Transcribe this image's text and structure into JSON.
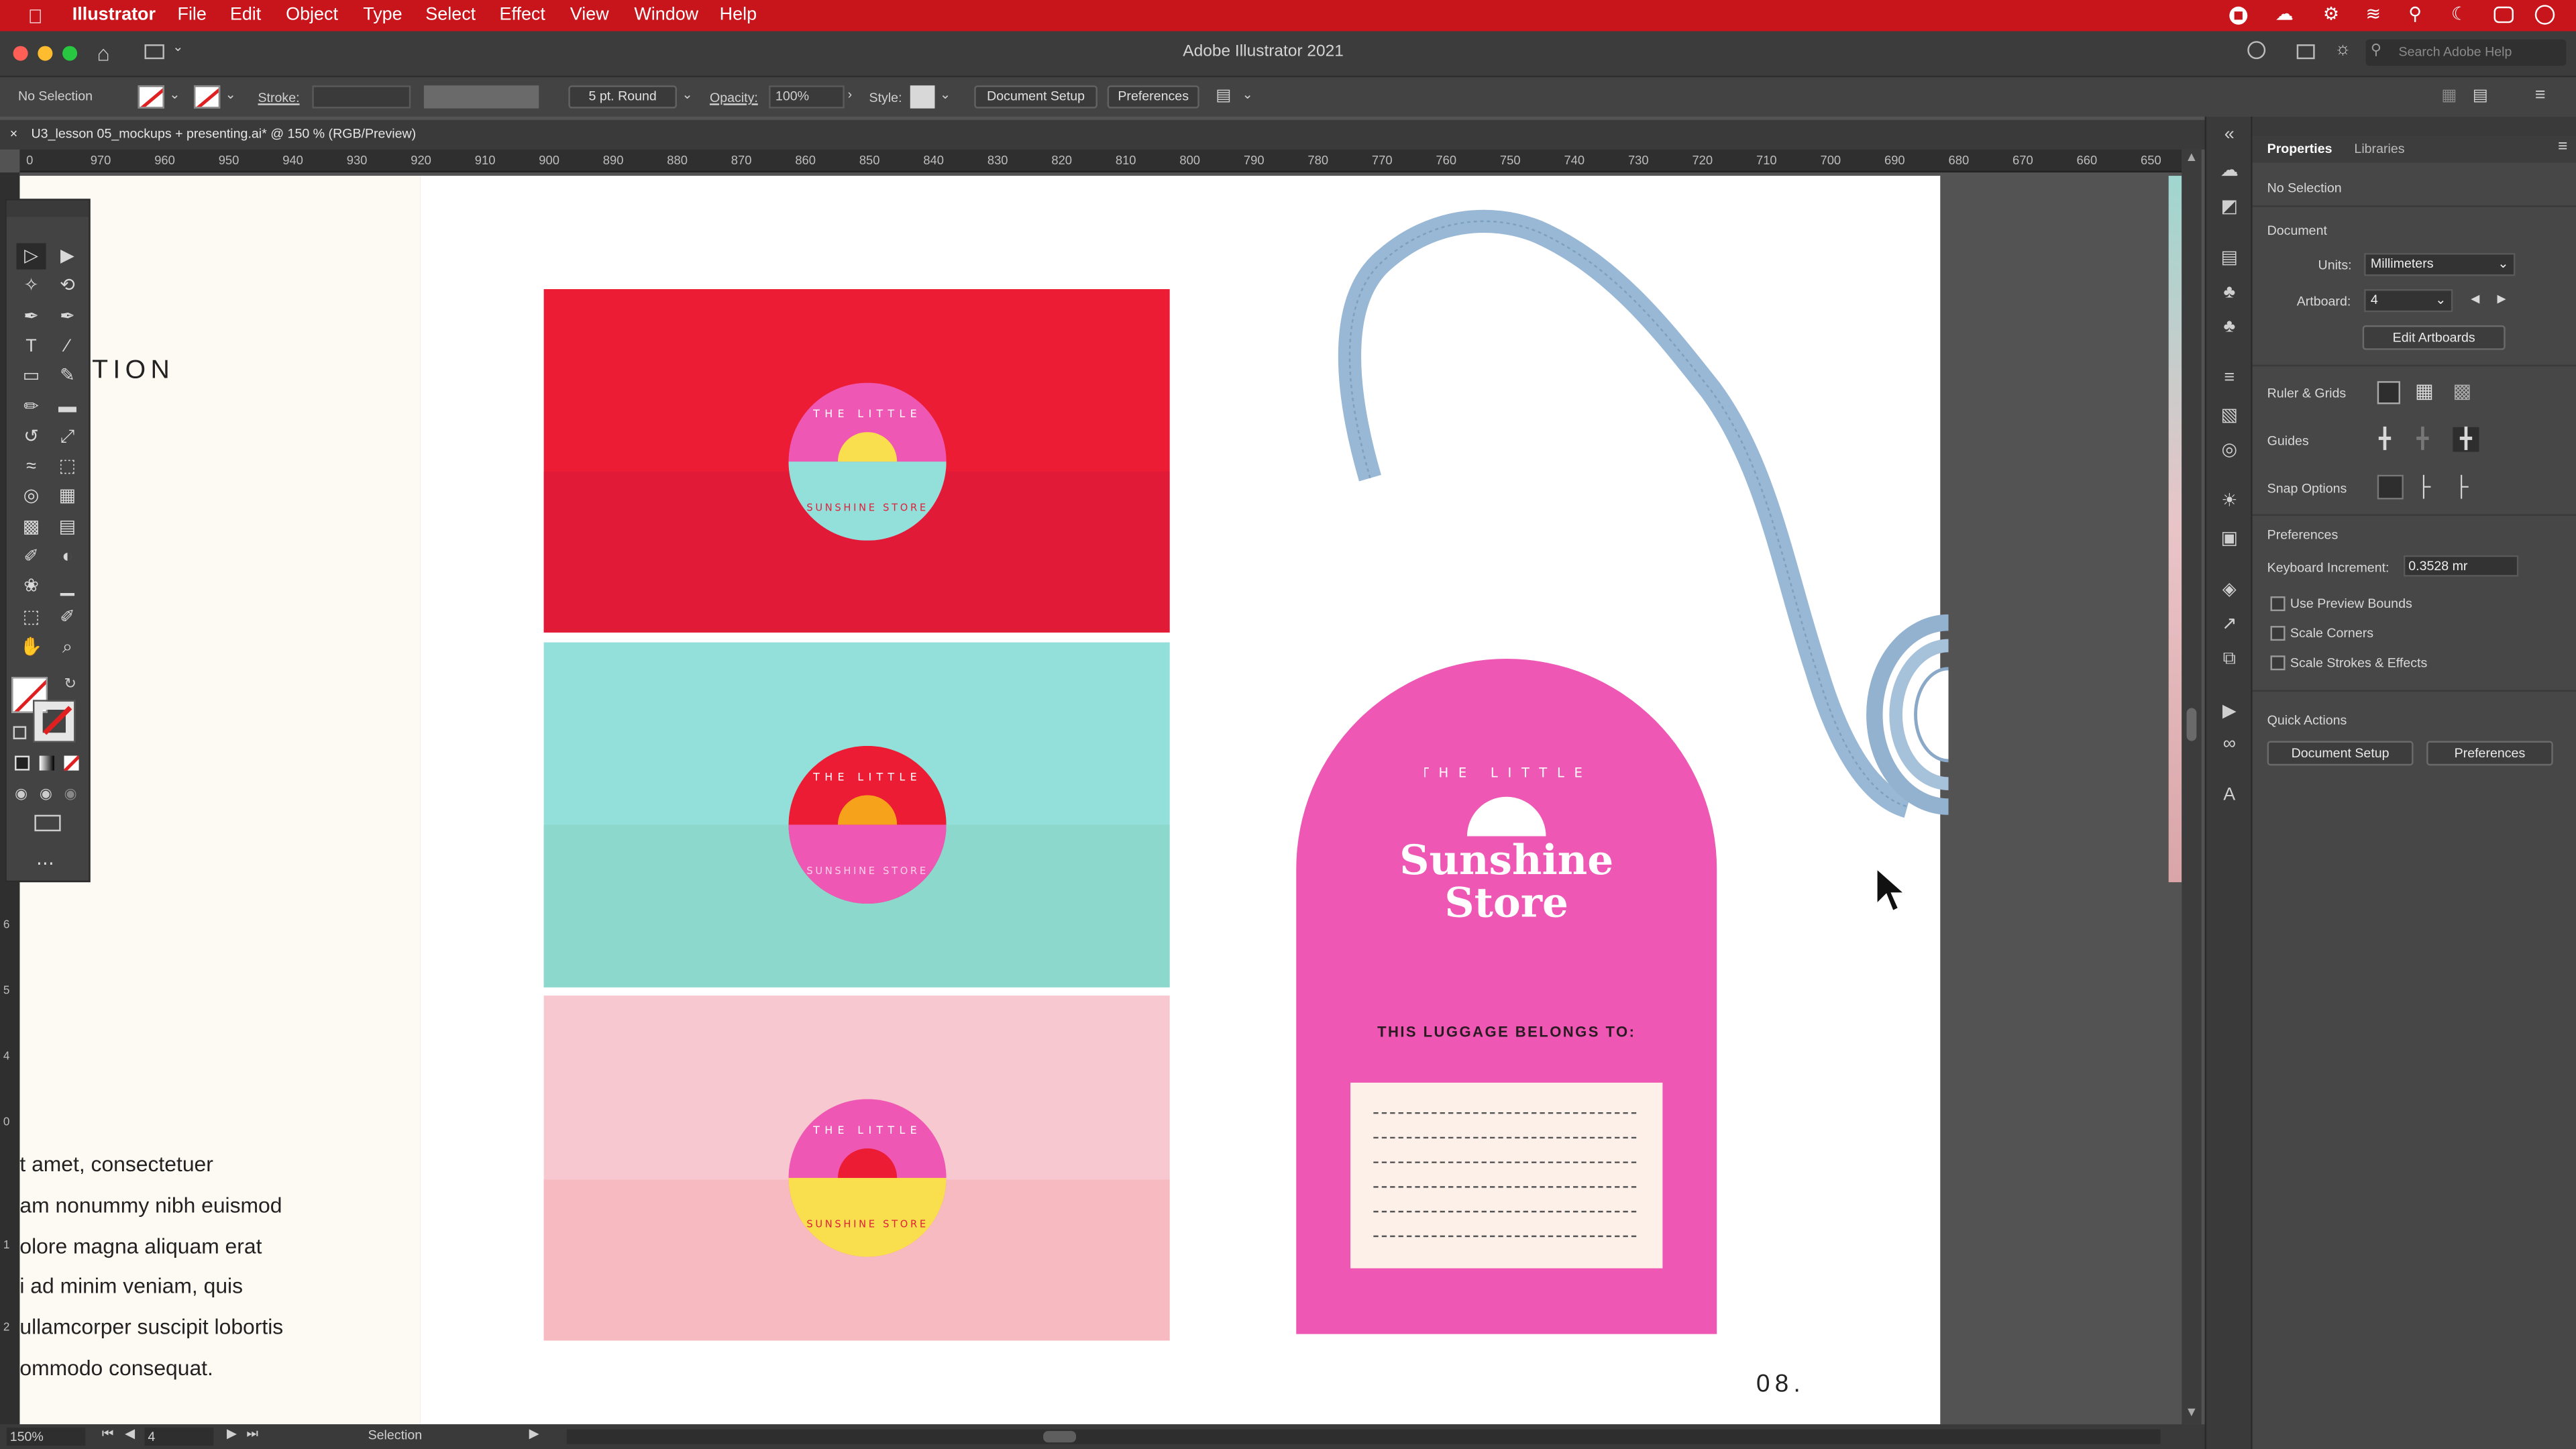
{
  "menubar": {
    "app": "Illustrator",
    "items": [
      "File",
      "Edit",
      "Object",
      "Type",
      "Select",
      "Effect",
      "View",
      "Window",
      "Help"
    ]
  },
  "titlebar": {
    "title": "Adobe Illustrator 2021",
    "search_placeholder": "Search Adobe Help"
  },
  "controlbar": {
    "selection": "No Selection",
    "stroke_label": "Stroke:",
    "brush": "5 pt. Round",
    "opacity_label": "Opacity:",
    "opacity_value": "100%",
    "style_label": "Style:",
    "document_setup": "Document Setup",
    "preferences": "Preferences"
  },
  "document_tab": {
    "title": "U3_lesson 05_mockups + presenting.ai* @ 150 % (RGB/Preview)"
  },
  "ruler": {
    "h_ticks": [
      "0",
      "970",
      "960",
      "950",
      "940",
      "930",
      "920",
      "910",
      "900",
      "890",
      "880",
      "870",
      "860",
      "850",
      "840",
      "830",
      "820",
      "810",
      "800",
      "790",
      "780",
      "770",
      "760",
      "750",
      "740",
      "730",
      "720",
      "710",
      "700",
      "690",
      "680",
      "670",
      "660",
      "650"
    ],
    "v_ticks": [
      "6",
      "5",
      "4",
      "0",
      "1",
      "2"
    ]
  },
  "artwork": {
    "left_heading": "TION",
    "left_body": [
      "t amet, consectetuer",
      "am nonummy nibh euismod",
      "olore magna aliquam erat",
      "i ad minim veniam, quis",
      "ullamcorper suscipit lobortis",
      "ommodo consequat."
    ],
    "logo_text_top": "THE LITTLE",
    "logo_text_bottom": "SUNSHINE STORE",
    "tag_small": "THE LITTLE",
    "tag_title_1": "Sunshine",
    "tag_title_2": "Store",
    "tag_caption": "THIS LUGGAGE BELONGS TO:",
    "page_number": "08."
  },
  "statusbar": {
    "zoom": "150%",
    "artboard": "4",
    "tool": "Selection"
  },
  "properties": {
    "tabs": [
      "Properties",
      "Libraries"
    ],
    "selection": "No Selection",
    "section_document": "Document",
    "units_label": "Units:",
    "units_value": "Millimeters",
    "artboard_label": "Artboard:",
    "artboard_value": "4",
    "edit_artboards": "Edit Artboards",
    "ruler_grids": "Ruler & Grids",
    "guides": "Guides",
    "snap_options": "Snap Options",
    "section_preferences": "Preferences",
    "keyboard_increment_label": "Keyboard Increment:",
    "keyboard_increment_value": "0.3528 mr",
    "use_preview_bounds": "Use Preview Bounds",
    "scale_corners": "Scale Corners",
    "scale_strokes": "Scale Strokes & Effects",
    "quick_actions": "Quick Actions",
    "qa_document_setup": "Document Setup",
    "qa_preferences": "Preferences"
  },
  "colors": {
    "menubar": "#c8151b",
    "red_card": "#ec1c34",
    "teal_card": "#93e0da",
    "pink_card": "#f7c8cf",
    "magenta": "#ee58b4",
    "yellow": "#f9df4e"
  },
  "icons": {
    "apple": "apple-icon",
    "home": "home-icon",
    "search": "search-icon",
    "brand_badge": "brand-logo-icon"
  }
}
